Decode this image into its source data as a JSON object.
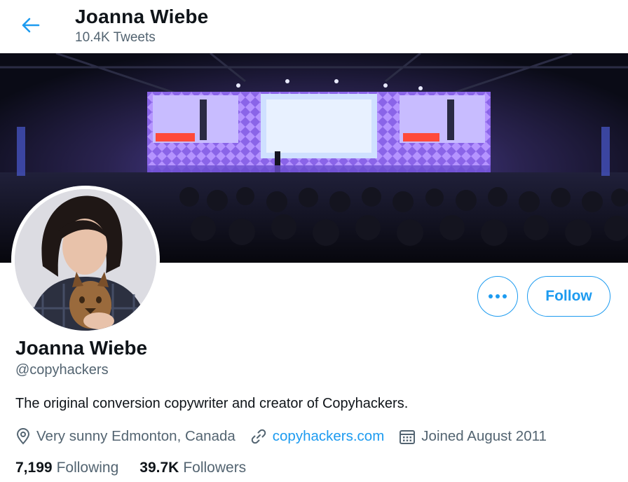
{
  "header": {
    "name": "Joanna Wiebe",
    "tweet_count": "10.4K Tweets"
  },
  "profile": {
    "display_name": "Joanna Wiebe",
    "handle": "@copyhackers",
    "bio": "The original conversion copywriter and creator of Copyhackers.",
    "location": "Very sunny Edmonton, Canada",
    "website": "copyhackers.com",
    "joined": "Joined August 2011",
    "following_count": "7,199",
    "following_label": "Following",
    "followers_count": "39.7K",
    "followers_label": "Followers"
  },
  "actions": {
    "follow_label": "Follow"
  },
  "colors": {
    "accent": "#1d9bf0",
    "text_primary": "#0f1419",
    "text_secondary": "#536471"
  },
  "icons": {
    "back": "arrow-left-icon",
    "more": "more-horizontal-icon",
    "location": "location-pin-icon",
    "link": "link-icon",
    "calendar": "calendar-icon"
  }
}
